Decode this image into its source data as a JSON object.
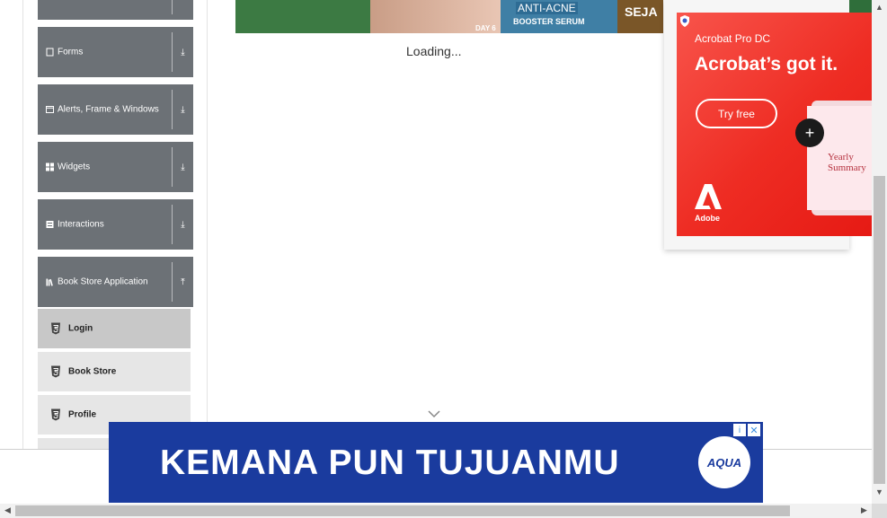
{
  "sidebar": {
    "groups": [
      {
        "label": "",
        "icon": "none"
      },
      {
        "label": "Forms",
        "icon": "form-icon"
      },
      {
        "label": "Alerts, Frame & Windows",
        "icon": "window-icon"
      },
      {
        "label": "Widgets",
        "icon": "grid-icon"
      },
      {
        "label": "Interactions",
        "icon": "list-icon"
      },
      {
        "label": "Book Store Application",
        "icon": "book-icon"
      }
    ],
    "toggle_collapsed": "⤓",
    "toggle_expanded": "⤒",
    "subitems": [
      {
        "label": "Login",
        "active": true
      },
      {
        "label": "Book Store",
        "active": false
      },
      {
        "label": "Profile",
        "active": false
      }
    ]
  },
  "main": {
    "loading_text": "Loading..."
  },
  "top_banner": {
    "text1": "ANTI-ACNE",
    "text2": "BOOSTER SERUM",
    "text3": "DAY 6",
    "text4": "SEJA"
  },
  "acrobat_ad": {
    "product": "Acrobat Pro DC",
    "headline": "Acrobat’s got it.",
    "cta": "Try free",
    "brand": "Adobe",
    "screen_text": "Yearly Summary",
    "plus": "+"
  },
  "aqua_ad": {
    "text": "KEMANA PUN TUJUANMU",
    "logo": "AQUA",
    "info": "i",
    "close": "✕"
  },
  "colors": {
    "sidebar_group": "#6c7176",
    "sub_active": "#c8c8c8",
    "sub_default": "#e6e6e6",
    "acrobat_red": "#ee2c23",
    "aqua_blue": "#1a3b9e"
  }
}
